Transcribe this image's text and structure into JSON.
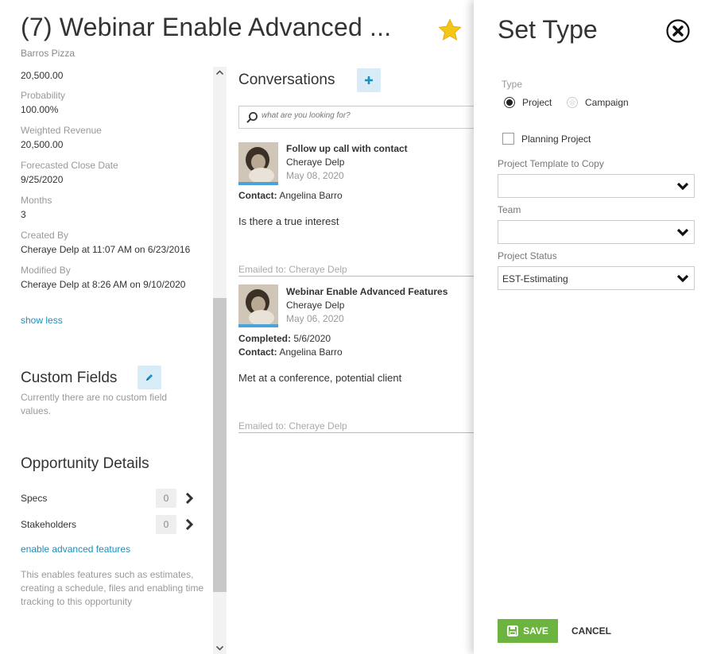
{
  "header": {
    "title": "(7) Webinar Enable Advanced ...",
    "subtitle": "Barros Pizza",
    "star_icon": "star-icon"
  },
  "left": {
    "top_value": "20,500.00",
    "fields": [
      {
        "label": "Probability",
        "value": "100.00%"
      },
      {
        "label": "Weighted Revenue",
        "value": "20,500.00"
      },
      {
        "label": "Forecasted Close Date",
        "value": "9/25/2020"
      },
      {
        "label": "Months",
        "value": "3"
      },
      {
        "label": "Created By",
        "value": "Cheraye Delp at 11:07 AM on 6/23/2016"
      },
      {
        "label": "Modified By",
        "value": "Cheraye Delp at 8:26 AM on 9/10/2020"
      }
    ],
    "show_less": "show less",
    "custom_fields_title": "Custom Fields",
    "custom_fields_empty": "Currently there are no custom field values.",
    "opportunity_details_title": "Opportunity Details",
    "details": [
      {
        "label": "Specs",
        "count": "0"
      },
      {
        "label": "Stakeholders",
        "count": "0"
      }
    ],
    "enable_link": "enable advanced features",
    "enable_desc": "This enables features such as estimates, creating a schedule, files and enabling time tracking to this opportunity"
  },
  "conversations": {
    "title": "Conversations",
    "search_placeholder": "what are you looking for?",
    "items": [
      {
        "subject": "Follow up call with contact",
        "author": "Cheraye Delp",
        "date": "May 08, 2020",
        "contact_label": "Contact:",
        "contact": "Angelina Barro",
        "body": "Is there a true interest",
        "emailed": "Emailed to: Cheraye Delp"
      },
      {
        "subject": "Webinar Enable Advanced Features",
        "author": "Cheraye Delp",
        "date": "May 06, 2020",
        "completed_label": "Completed:",
        "completed": "5/6/2020",
        "contact_label": "Contact:",
        "contact": "Angelina Barro",
        "body": "Met at a conference, potential client",
        "emailed": "Emailed to: Cheraye Delp"
      }
    ]
  },
  "panel": {
    "title": "Set Type",
    "type_label": "Type",
    "type_options": [
      "Project",
      "Campaign"
    ],
    "type_selected": "Project",
    "planning_project_label": "Planning Project",
    "planning_project_checked": false,
    "template_label": "Project Template to Copy",
    "template_value": "",
    "team_label": "Team",
    "team_value": "",
    "status_label": "Project Status",
    "status_value": "EST-Estimating",
    "save_label": "SAVE",
    "cancel_label": "CANCEL"
  },
  "colors": {
    "accent_blue": "#1b8fbf",
    "save_green": "#6db33f",
    "star_yellow": "#f5c518",
    "light_blue_btn": "#d7ecf7"
  }
}
